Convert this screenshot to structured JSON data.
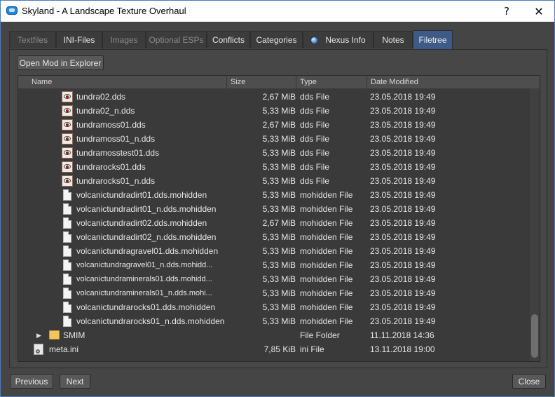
{
  "window": {
    "title": "Skyland - A Landscape Texture Overhaul",
    "help_glyph": "?",
    "close_glyph": "✕"
  },
  "tabs": [
    {
      "label": "Textfiles",
      "state": "disabled"
    },
    {
      "label": "INI-Files",
      "state": "enabled"
    },
    {
      "label": "Images",
      "state": "disabled"
    },
    {
      "label": "Optional ESPs",
      "state": "disabled"
    },
    {
      "label": "Conflicts",
      "state": "enabled"
    },
    {
      "label": "Categories",
      "state": "enabled"
    },
    {
      "label": "Nexus Info",
      "state": "enabled",
      "icon": "globe-icon"
    },
    {
      "label": "Notes",
      "state": "enabled"
    },
    {
      "label": "Filetree",
      "state": "active"
    }
  ],
  "filetree": {
    "open_button": "Open Mod in Explorer",
    "columns": {
      "name": "Name",
      "size": "Size",
      "type": "Type",
      "date": "Date Modified"
    },
    "rows": [
      {
        "name": "tundra02.dds",
        "size": "2,67 MiB",
        "type": "dds File",
        "date": "23.05.2018 19:49",
        "icon": "dds-image-icon"
      },
      {
        "name": "tundra02_n.dds",
        "size": "5,33 MiB",
        "type": "dds File",
        "date": "23.05.2018 19:49",
        "icon": "dds-image-icon"
      },
      {
        "name": "tundramoss01.dds",
        "size": "2,67 MiB",
        "type": "dds File",
        "date": "23.05.2018 19:49",
        "icon": "dds-image-icon"
      },
      {
        "name": "tundramoss01_n.dds",
        "size": "5,33 MiB",
        "type": "dds File",
        "date": "23.05.2018 19:49",
        "icon": "dds-image-icon"
      },
      {
        "name": "tundramosstest01.dds",
        "size": "5,33 MiB",
        "type": "dds File",
        "date": "23.05.2018 19:49",
        "icon": "dds-image-icon"
      },
      {
        "name": "tundrarocks01.dds",
        "size": "5,33 MiB",
        "type": "dds File",
        "date": "23.05.2018 19:49",
        "icon": "dds-image-icon"
      },
      {
        "name": "tundrarocks01_n.dds",
        "size": "5,33 MiB",
        "type": "dds File",
        "date": "23.05.2018 19:49",
        "icon": "dds-image-icon"
      },
      {
        "name": "volcanictundradirt01.dds.mohidden",
        "size": "5,33 MiB",
        "type": "mohidden File",
        "date": "23.05.2018 19:49",
        "icon": "blank-file-icon"
      },
      {
        "name": "volcanictundradirt01_n.dds.mohidden",
        "size": "5,33 MiB",
        "type": "mohidden File",
        "date": "23.05.2018 19:49",
        "icon": "blank-file-icon"
      },
      {
        "name": "volcanictundradirt02.dds.mohidden",
        "size": "2,67 MiB",
        "type": "mohidden File",
        "date": "23.05.2018 19:49",
        "icon": "blank-file-icon"
      },
      {
        "name": "volcanictundradirt02_n.dds.mohidden",
        "size": "5,33 MiB",
        "type": "mohidden File",
        "date": "23.05.2018 19:49",
        "icon": "blank-file-icon"
      },
      {
        "name": "volcanictundragravel01.dds.mohidden",
        "size": "5,33 MiB",
        "type": "mohidden File",
        "date": "23.05.2018 19:49",
        "icon": "blank-file-icon"
      },
      {
        "name": "volcanictundragravel01_n.dds.mohidd...",
        "size": "5,33 MiB",
        "type": "mohidden File",
        "date": "23.05.2018 19:49",
        "icon": "blank-file-icon"
      },
      {
        "name": "volcanictundraminerals01.dds.mohidd...",
        "size": "5,33 MiB",
        "type": "mohidden File",
        "date": "23.05.2018 19:49",
        "icon": "blank-file-icon"
      },
      {
        "name": "volcanictundraminerals01_n.dds.mohi...",
        "size": "5,33 MiB",
        "type": "mohidden File",
        "date": "23.05.2018 19:49",
        "icon": "blank-file-icon"
      },
      {
        "name": "volcanictundrarocks01.dds.mohidden",
        "size": "5,33 MiB",
        "type": "mohidden File",
        "date": "23.05.2018 19:49",
        "icon": "blank-file-icon"
      },
      {
        "name": "volcanictundrarocks01_n.dds.mohidden",
        "size": "5,33 MiB",
        "type": "mohidden File",
        "date": "23.05.2018 19:49",
        "icon": "blank-file-icon"
      },
      {
        "name": "SMIM",
        "size": "",
        "type": "File Folder",
        "date": "11.11.2018 14:36",
        "icon": "folder-icon",
        "expander": "▶"
      },
      {
        "name": "meta.ini",
        "size": "7,85 KiB",
        "type": "ini File",
        "date": "13.11.2018 19:00",
        "icon": "ini-settings-icon"
      }
    ]
  },
  "footer": {
    "previous": "Previous",
    "next": "Next",
    "close": "Close"
  }
}
